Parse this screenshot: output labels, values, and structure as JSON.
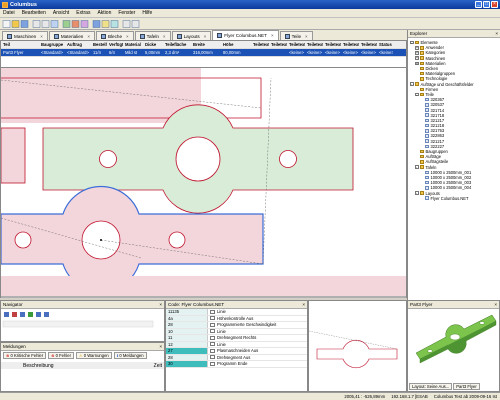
{
  "app": {
    "title": "Columbus"
  },
  "menu": [
    "Datei",
    "Bearbeiten",
    "Ansicht",
    "Extras",
    "Aktion",
    "Fenster",
    "Hilfe"
  ],
  "tabs": [
    {
      "label": "Maschinen",
      "active": false
    },
    {
      "label": "Materialien",
      "active": false
    },
    {
      "label": "Bleche",
      "active": false
    },
    {
      "label": "Tafeln",
      "active": false
    },
    {
      "label": "Layouts",
      "active": false
    },
    {
      "label": "Flyer Columbus.NET",
      "active": true
    },
    {
      "label": "Teile",
      "active": false
    }
  ],
  "grid": {
    "columns": [
      "Teil",
      "Baugruppe",
      "Auftrag",
      "Bestellt",
      "Verfügt",
      "Material",
      "Dicke",
      "Teilefläche",
      "Breite",
      "Höhe",
      "Teiletext",
      "Teiletext",
      "Teiletext",
      "Teiletext",
      "Teiletext",
      "Teiletext",
      "Teiletext",
      "Status"
    ],
    "row": [
      "Part3 Flyer",
      "<Standard>",
      "<Standard>",
      "11/4",
      "6/4",
      "Mild st",
      "5,00mm",
      "2,3 dm²",
      "316,00mm",
      "80,00mm",
      "",
      "",
      "<keine>",
      "<keine>",
      "<keine>",
      "<keine>",
      "<keine>",
      "<keine>"
    ]
  },
  "explorer": {
    "title": "Explorer",
    "items": [
      {
        "label": "Elemente",
        "depth": 0,
        "expand": "-",
        "kind": "folder"
      },
      {
        "label": "Anwender",
        "depth": 1,
        "expand": "+",
        "kind": "folder"
      },
      {
        "label": "Kategorien",
        "depth": 1,
        "expand": "+",
        "kind": "folder"
      },
      {
        "label": "Maschinen",
        "depth": 1,
        "expand": "+",
        "kind": "folder"
      },
      {
        "label": "Materialien",
        "depth": 1,
        "expand": "+",
        "kind": "folder"
      },
      {
        "label": "Dicken",
        "depth": 1,
        "expand": "",
        "kind": "folder"
      },
      {
        "label": "Materialgruppen",
        "depth": 1,
        "expand": "",
        "kind": "folder"
      },
      {
        "label": "Technologie",
        "depth": 1,
        "expand": "",
        "kind": "folder"
      },
      {
        "label": "Aufträge und Geschäftsfelder",
        "depth": 0,
        "expand": "-",
        "kind": "folder"
      },
      {
        "label": "Firmen",
        "depth": 1,
        "expand": "",
        "kind": "folder"
      },
      {
        "label": "Teile",
        "depth": 1,
        "expand": "-",
        "kind": "folder"
      },
      {
        "label": "320367",
        "depth": 2,
        "expand": "",
        "kind": "doc"
      },
      {
        "label": "320537",
        "depth": 2,
        "expand": "",
        "kind": "doc"
      },
      {
        "label": "321714",
        "depth": 2,
        "expand": "",
        "kind": "doc"
      },
      {
        "label": "321718",
        "depth": 2,
        "expand": "",
        "kind": "doc"
      },
      {
        "label": "321217",
        "depth": 2,
        "expand": "",
        "kind": "doc"
      },
      {
        "label": "321218",
        "depth": 2,
        "expand": "",
        "kind": "doc"
      },
      {
        "label": "321763",
        "depth": 2,
        "expand": "",
        "kind": "doc"
      },
      {
        "label": "322863",
        "depth": 2,
        "expand": "",
        "kind": "doc"
      },
      {
        "label": "321217",
        "depth": 2,
        "expand": "",
        "kind": "doc"
      },
      {
        "label": "322227",
        "depth": 2,
        "expand": "",
        "kind": "doc"
      },
      {
        "label": "Baugruppen",
        "depth": 1,
        "expand": "",
        "kind": "folder"
      },
      {
        "label": "Aufträge",
        "depth": 1,
        "expand": "",
        "kind": "folder"
      },
      {
        "label": "Auftragsteile",
        "depth": 1,
        "expand": "",
        "kind": "folder"
      },
      {
        "label": "Tafeln",
        "depth": 1,
        "expand": "-",
        "kind": "folder"
      },
      {
        "label": "10000 x 2500mm_001",
        "depth": 2,
        "expand": "",
        "kind": "doc"
      },
      {
        "label": "10000 x 2500mm_002",
        "depth": 2,
        "expand": "",
        "kind": "doc"
      },
      {
        "label": "10000 x 2500mm_003",
        "depth": 2,
        "expand": "",
        "kind": "doc"
      },
      {
        "label": "10000 x 2500mm_004",
        "depth": 2,
        "expand": "",
        "kind": "doc"
      },
      {
        "label": "Layouts",
        "depth": 1,
        "expand": "-",
        "kind": "folder"
      },
      {
        "label": "Flyer Columbus.NET",
        "depth": 2,
        "expand": "",
        "kind": "doc"
      }
    ]
  },
  "navigator": {
    "title": "Navigator"
  },
  "meldungen": {
    "title": "Meldungen",
    "buttons": [
      "0 Kritische Fehler",
      "0 Fehler",
      "0 Warnungen",
      "0 Meldungen"
    ],
    "column": "Beschreibung",
    "column2": "Zeit"
  },
  "codepanel": {
    "title": "Code: Flyer Columbus.NET",
    "rows": [
      {
        "num": "11135",
        "text": "Linie",
        "hl": false
      },
      {
        "num": "4a",
        "text": "Höhenkontrolle Aus",
        "hl": false
      },
      {
        "num": "28",
        "text": "Programmierte Geschwindigkeit",
        "hl": false
      },
      {
        "num": "10",
        "text": "Linie",
        "hl": false
      },
      {
        "num": "11",
        "text": "Drehsegment Rechts",
        "hl": false
      },
      {
        "num": "12",
        "text": "Linie",
        "hl": false
      },
      {
        "num": "27",
        "text": "Plasmaschneiden Aus",
        "hl": true
      },
      {
        "num": "28",
        "text": "Drehsegment Aus",
        "hl": false
      },
      {
        "num": "30",
        "text": "Programm Ende",
        "hl": true
      }
    ]
  },
  "part3d": {
    "title": "Part3 Flyer"
  },
  "tabs_bottom": [
    "Layout: Seine Aus...",
    "Part3 Flyer"
  ],
  "statusbar": {
    "coords": "2005,41 : -526,89mm",
    "ip": "192.168.1.7 [ESAB",
    "build": "Columbus Test ab 2009-09-16  Ist"
  },
  "colors": {
    "part_fill": "#f3d6dc",
    "part_selected_fill": "#d8ecd8",
    "part_outline": "#c0122c",
    "blue_outline": "#3c6dd8"
  }
}
